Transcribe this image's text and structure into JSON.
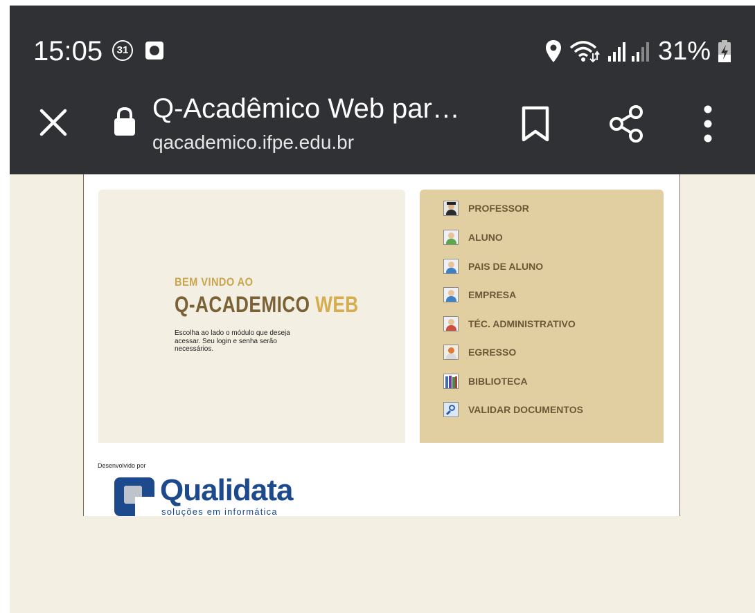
{
  "status_bar": {
    "time": "15:05",
    "notification_badge": "31",
    "battery": "31%",
    "icons": [
      "calendar-badge-icon",
      "app-notification-icon",
      "location-icon",
      "wifi-icon",
      "signal-icon",
      "battery-charging-icon"
    ]
  },
  "browser": {
    "page_title": "Q-Acadêmico Web par…",
    "url": "qacademico.ifpe.edu.br",
    "icons": [
      "close-icon",
      "lock-icon",
      "bookmark-icon",
      "share-icon",
      "more-icon"
    ]
  },
  "welcome": {
    "line1": "BEM VINDO AO",
    "title_part1": "Q-ACADEMICO",
    "title_part2": "WEB",
    "description": "Escolha ao lado o módulo que deseja acessar. Seu login e senha serão necessários."
  },
  "modules": [
    {
      "label": "PROFESSOR",
      "icon": "professor-icon"
    },
    {
      "label": "ALUNO",
      "icon": "student-icon"
    },
    {
      "label": "PAIS DE ALUNO",
      "icon": "parents-icon"
    },
    {
      "label": "EMPRESA",
      "icon": "company-icon"
    },
    {
      "label": "TÉC. ADMINISTRATIVO",
      "icon": "admin-icon"
    },
    {
      "label": "EGRESSO",
      "icon": "graduate-icon"
    },
    {
      "label": "BIBLIOTECA",
      "icon": "library-icon"
    },
    {
      "label": "VALIDAR DOCUMENTOS",
      "icon": "validate-documents-icon"
    }
  ],
  "footer": {
    "developed_by": "Desenvolvido por",
    "logo_text": "Qualidata",
    "logo_subtitle": "soluções em informática"
  },
  "colors": {
    "chrome": "#303134",
    "page_background": "#f4efe3",
    "menu_background": "#e2cfa1",
    "menu_text": "#6b5838",
    "gold": "#d4ad4f",
    "brand_blue": "#1c4a8c"
  }
}
